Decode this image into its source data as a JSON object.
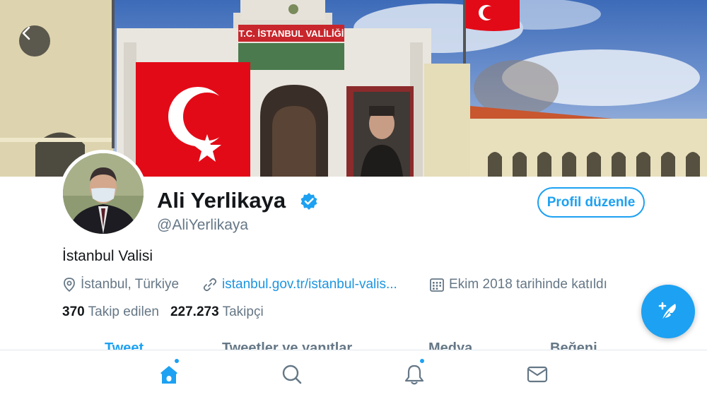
{
  "profile": {
    "name": "Ali Yerlikaya",
    "handle": "@AliYerlikaya",
    "bio": "İstanbul Valisi",
    "location": "İstanbul, Türkiye",
    "website": "istanbul.gov.tr/istanbul-valis...",
    "joined": "Ekim 2018 tarihinde katıldı",
    "verified": true
  },
  "banner": {
    "building_sign": "T.C. İSTANBUL VALİLİĞİ"
  },
  "buttons": {
    "edit_profile": "Profil düzenle"
  },
  "stats": {
    "following_count": "370",
    "following_label": "Takip edilen",
    "followers_count": "227.273",
    "followers_label": "Takipçi"
  },
  "tabs": [
    "Tweet",
    "Tweetler ve yanıtlar",
    "Medya",
    "Beğeni"
  ],
  "bottom_nav": {
    "items": [
      "home-icon",
      "search-icon",
      "notifications-icon",
      "messages-icon"
    ],
    "active": "home-icon",
    "badges": [
      "home-icon",
      "notifications-icon"
    ]
  },
  "colors": {
    "accent": "#1da1f2",
    "link": "#1b95e0",
    "secondary_text": "#657786",
    "flag_red": "#e30a17"
  }
}
